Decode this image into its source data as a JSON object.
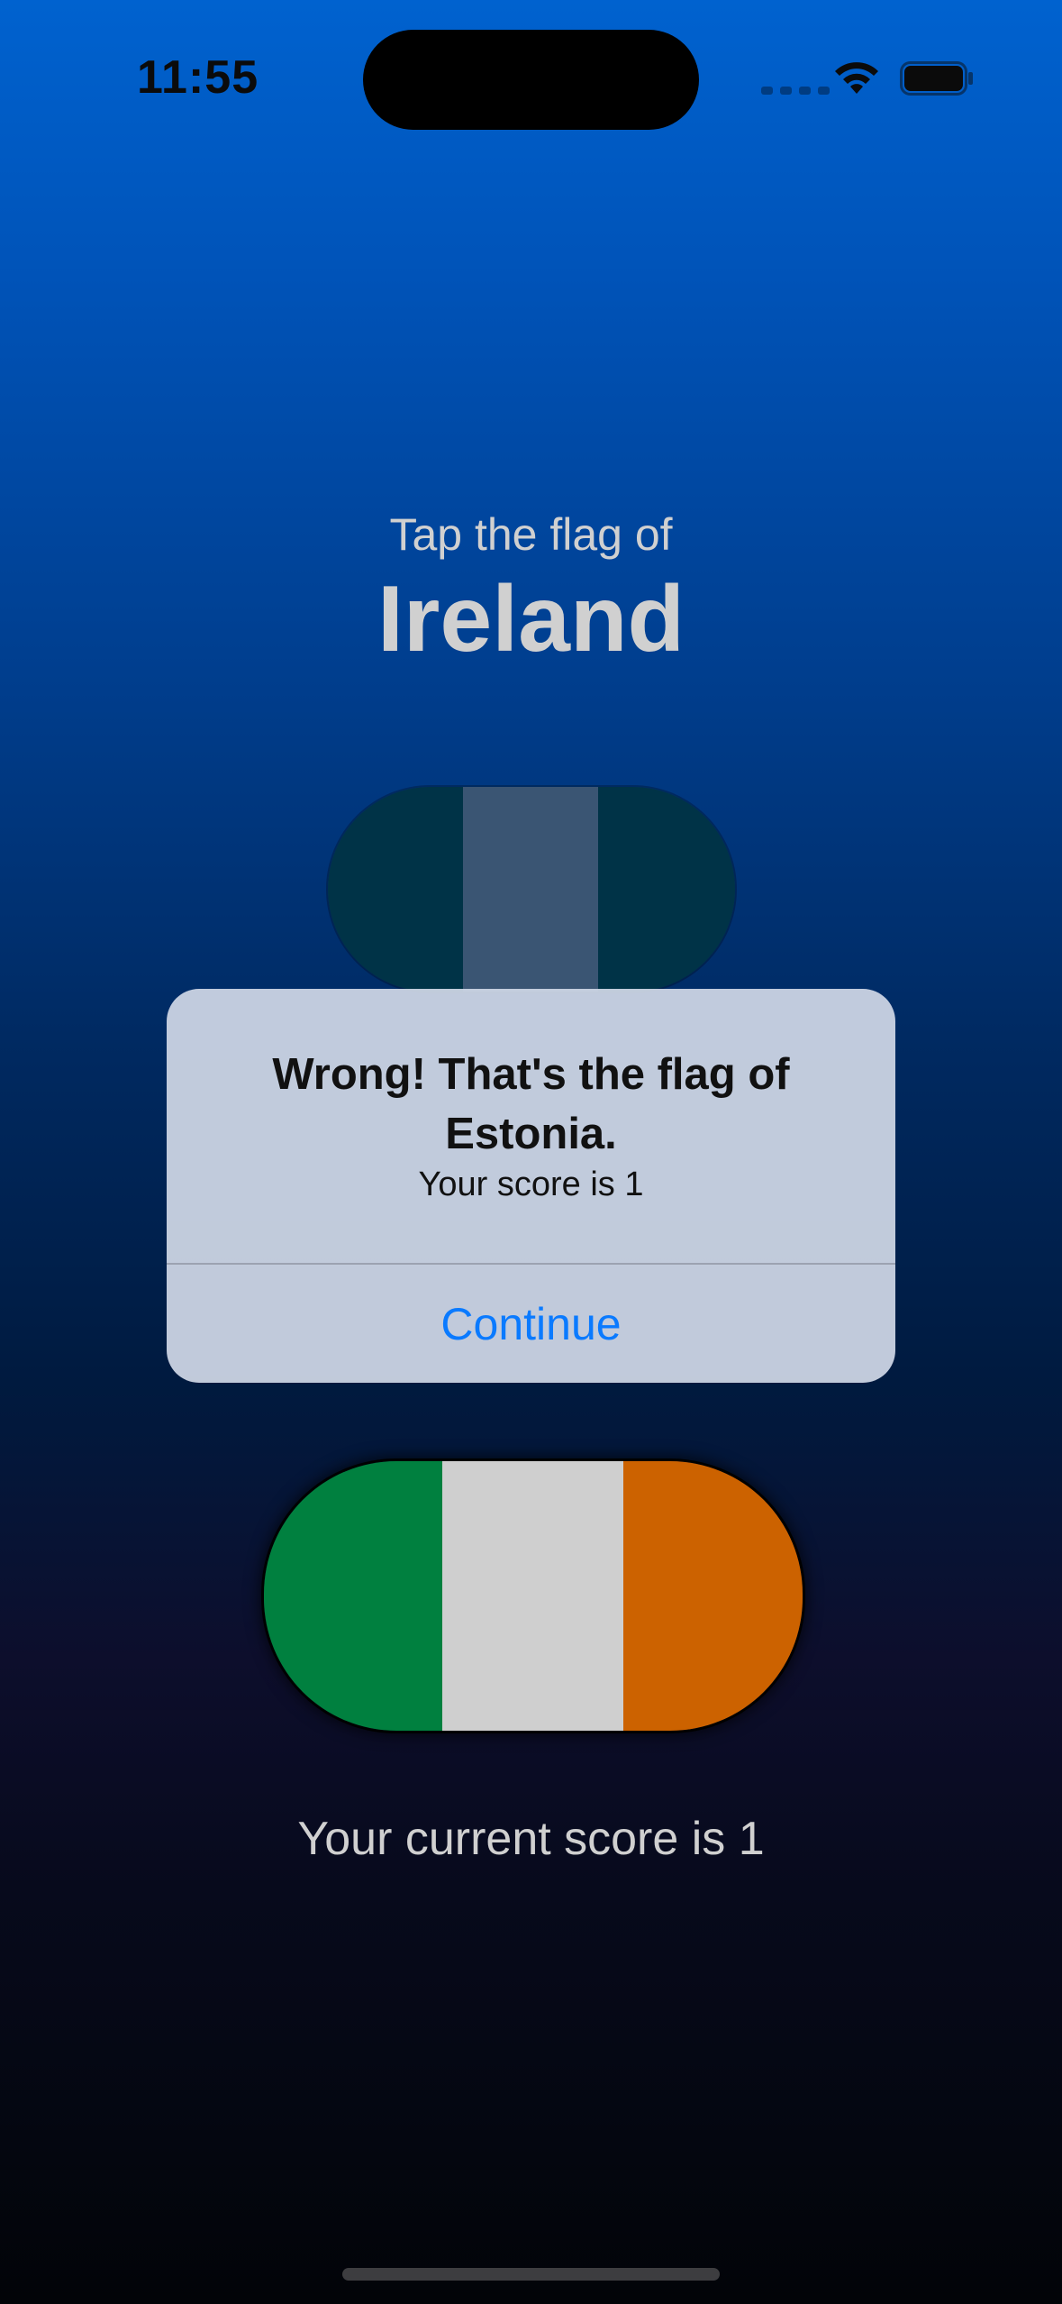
{
  "status_bar": {
    "time": "11:55",
    "icons": [
      "cellular-signal-icon",
      "wifi-icon",
      "battery-icon"
    ]
  },
  "game": {
    "prompt": "Tap the flag of",
    "country": "Ireland",
    "flags": [
      {
        "country": "Estonia",
        "colors": [
          "#0072ce",
          "#000000",
          "#ffffff"
        ]
      },
      {
        "country": "Ireland",
        "colors": [
          "#00803f",
          "#cfcfcf",
          "#cc6200"
        ]
      }
    ],
    "score_text": "Your current score is 1"
  },
  "alert": {
    "title": "Wrong! That's the flag of Estonia.",
    "message": "Your score is 1",
    "button_label": "Continue"
  },
  "colors": {
    "accent": "#0a7aff",
    "background_top": "#0062cf",
    "background_bottom": "#020408"
  }
}
